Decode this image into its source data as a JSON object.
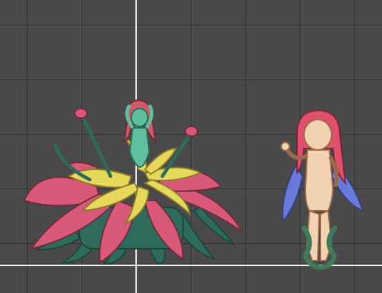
{
  "scene": {
    "background_color": "#4a4a4a",
    "grid_color": "#2a2a2a",
    "origin_axis_color": "#f2f2f2"
  },
  "sprites": [
    {
      "name": "flower-monster-girl",
      "colors": {
        "petal_outer": "#d85a78",
        "petal_inner": "#e6d85a",
        "stem": "#2f6b5a",
        "skin": "#5fc0a0",
        "hair": "#d05a6a"
      }
    },
    {
      "name": "captured-fairy-girl",
      "colors": {
        "skin": "#f2d2b0",
        "hair": "#e0506a",
        "wings": "#6a7ad8",
        "vine": "#3f7a5a"
      }
    }
  ]
}
